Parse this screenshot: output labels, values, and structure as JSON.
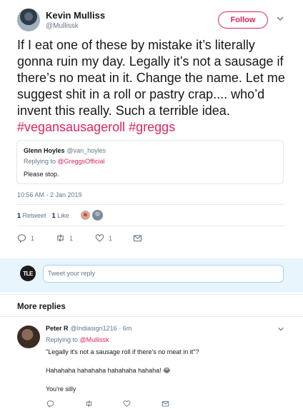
{
  "tweet": {
    "author_name": "Kevin Mulliss",
    "author_handle": "@Mullissk",
    "follow_label": "Follow",
    "text_main": "If I eat one of these by mistake it’s literally gonna ruin my day.     Legally it’s not a sausage if there’s no meat in it. Change the name. Let me suggest shit in a roll or pastry crap.... who’d invent this really. Such a terrible idea. ",
    "hashtag_1": "#vegansausageroll",
    "hashtag_2": "#greggs",
    "quoted": {
      "name": "Glenn Hoyles",
      "handle": "@van_hoyles",
      "replying_prefix": "Replying to ",
      "replying_to": "@GreggsOfficial",
      "text": "Please stop."
    },
    "timestamp": "10:56 AM - 2 Jan 2019",
    "stats": {
      "retweets_count": "1",
      "retweets_label": "Retweet",
      "likes_count": "1",
      "likes_label": "Like"
    },
    "actions": {
      "reply_count": "1",
      "retweet_count": "1",
      "like_count": "1"
    }
  },
  "composer": {
    "avatar_text": "TLE",
    "placeholder": "Tweet your reply"
  },
  "more_replies": {
    "title": "More replies"
  },
  "reply": {
    "name": "Peter R",
    "handle": "@Indiasign1216",
    "time": "· 6m",
    "replying_prefix": "Replying to ",
    "replying_to": "@Mullissk",
    "line_1": "\"Legally it's not a sausage roll if there's no meat in it\"?",
    "line_2": "Hahahaha hahahaha hahahaha hahaha! 😂",
    "line_3": "You're silly"
  },
  "colors": {
    "accent": "#e0245e",
    "secondary_text": "#657786",
    "reply_bar_bg": "#e8f5fd"
  },
  "icons": [
    "caret-down-icon",
    "reply-icon",
    "retweet-icon",
    "heart-icon",
    "message-icon"
  ]
}
